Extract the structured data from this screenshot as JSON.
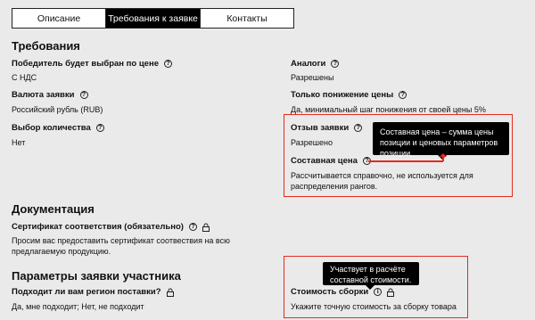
{
  "tabs": [
    "Описание",
    "Требования к заявке",
    "Контакты"
  ],
  "sections": {
    "requirements": "Требования",
    "documentation": "Документация",
    "bid_params": "Параметры заявки участника"
  },
  "fields": {
    "winner": {
      "label": "Победитель будет выбран по цене",
      "value": "С НДС"
    },
    "analogs": {
      "label": "Аналоги",
      "value": "Разрешены"
    },
    "currency": {
      "label": "Валюта заявки",
      "value": "Российский рубль (RUB)"
    },
    "only_decrease": {
      "label": "Только понижение цены",
      "value": "Да, минимальный шаг понижения от своей цены 5%"
    },
    "quantity": {
      "label": "Выбор количества",
      "value": "Нет"
    },
    "withdraw": {
      "label": "Отзыв заявки",
      "value": "Разрешено"
    },
    "composite_price": {
      "label": "Составная цена",
      "value": "Рассчитывается справочно, не используется для распределения рангов."
    },
    "certificate": {
      "label": "Сертификат соответствия (обязательно)",
      "value": "Просим вас предоставить сертификат соотвествия на всю предлагаемую продукцию."
    },
    "region": {
      "label": "Подходит ли вам регион поставки?",
      "value": "Да, мне подходит; Нет, не подходит"
    },
    "assembly_cost": {
      "label": "Стоимость сборки",
      "value": "Укажите точную стоимость за сборку товара"
    }
  },
  "tooltips": {
    "composite": "Составная цена – сумма цены позиции и ценовых параметров позиции.",
    "assembly": "Участвует в расчёте составной стоимости."
  },
  "icons": {
    "help": "?",
    "info": "i"
  },
  "colors": {
    "highlight": "#e52a1e",
    "tooltip_bg": "#000000",
    "active_tab": "#000000"
  }
}
